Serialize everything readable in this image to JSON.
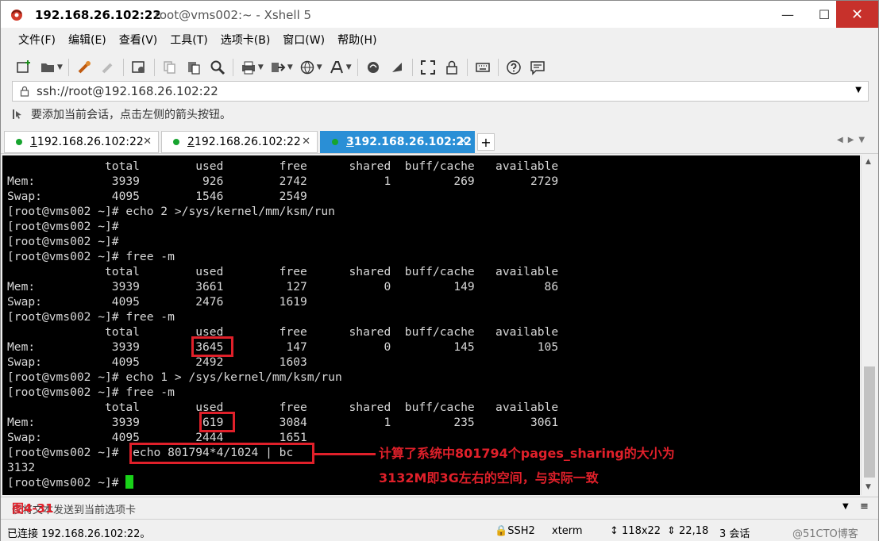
{
  "window": {
    "title_host": "192.168.26.102:22",
    "title_rest": "root@vms002:~ - Xshell 5",
    "min_label": "—",
    "max_label": "☐",
    "close_label": "✕"
  },
  "menu": [
    "文件(F)",
    "编辑(E)",
    "查看(V)",
    "工具(T)",
    "选项卡(B)",
    "窗口(W)",
    "帮助(H)"
  ],
  "address": {
    "value": "ssh://root@192.168.26.102:22"
  },
  "hint": "要添加当前会话，点击左侧的箭头按钮。",
  "tabs": [
    {
      "num": "1",
      "label": " 192.168.26.102:22",
      "active": false
    },
    {
      "num": "2",
      "label": " 192.168.26.102:22",
      "active": false
    },
    {
      "num": "3",
      "label": " 192.168.26.102:22",
      "active": true
    }
  ],
  "terminal": {
    "lines": [
      "              total        used        free      shared  buff/cache   available",
      "Mem:           3939         926        2742           1         269        2729",
      "Swap:          4095        1546        2549",
      "[root@vms002 ~]# echo 2 >/sys/kernel/mm/ksm/run",
      "[root@vms002 ~]#",
      "[root@vms002 ~]#",
      "[root@vms002 ~]# free -m",
      "              total        used        free      shared  buff/cache   available",
      "Mem:           3939        3661         127           0         149          86",
      "Swap:          4095        2476        1619",
      "[root@vms002 ~]# free -m",
      "              total        used        free      shared  buff/cache   available",
      "Mem:           3939        3645         147           0         145         105",
      "Swap:          4095        2492        1603",
      "[root@vms002 ~]# echo 1 > /sys/kernel/mm/ksm/run",
      "[root@vms002 ~]# free -m",
      "              total        used        free      shared  buff/cache   available",
      "Mem:           3939         619        3084           1         235        3061",
      "Swap:          4095        2444        1651",
      "[root@vms002 ~]#  echo 801794*4/1024 | bc",
      "3132"
    ],
    "prompt": "[root@vms002 ~]# "
  },
  "annotations": {
    "line1": "计算了系统中801794个pages_sharing的大小为",
    "line2": "3132M即3G左右的空间，与实际一致"
  },
  "sendbar": {
    "text": "仅将文本发送到当前选项卡",
    "figure_label": "图4-31"
  },
  "status": {
    "connection": "已连接 192.168.26.102:22。",
    "protocol": "SSH2",
    "term_type": "xterm",
    "size": "118x22",
    "cursor_pos": "22,18",
    "sessions": "3 会话",
    "watermark": "@51CTO博客"
  },
  "colors": {
    "accent_tab": "#2a8fd6",
    "highlight": "#e0202a",
    "cursor": "#19d219",
    "status_dot": "#17a42f"
  }
}
